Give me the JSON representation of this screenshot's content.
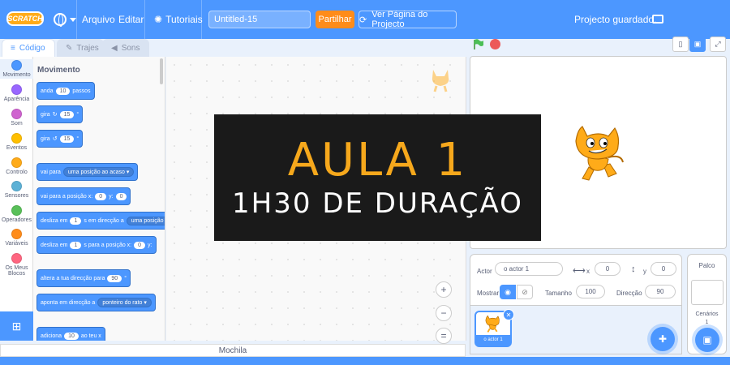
{
  "menu": {
    "logo": "SCRATCH",
    "file": "Arquivo",
    "edit": "Editar",
    "tutorials": "Tutoriais",
    "project_title": "Untitled-15",
    "share": "Partilhar",
    "see_project": "Ver Página do Projecto",
    "saved_status": "Projecto guardado."
  },
  "tabs": {
    "code": "Código",
    "costumes": "Trajes",
    "sounds": "Sons"
  },
  "categories": [
    {
      "label": "Movimento",
      "color": "#4c97ff"
    },
    {
      "label": "Aparência",
      "color": "#9966ff"
    },
    {
      "label": "Som",
      "color": "#cf63cf"
    },
    {
      "label": "Eventos",
      "color": "#ffbf00"
    },
    {
      "label": "Controlo",
      "color": "#ffab19"
    },
    {
      "label": "Sensores",
      "color": "#5cb1d6"
    },
    {
      "label": "Operadores",
      "color": "#59c059"
    },
    {
      "label": "Variáveis",
      "color": "#ff8c1a"
    },
    {
      "label": "Os Meus Blocos",
      "color": "#ff6680"
    }
  ],
  "palette": {
    "title": "Movimento",
    "move": {
      "a": "anda",
      "value": "10",
      "b": "passos"
    },
    "turn_right": {
      "a": "gira",
      "value": "15",
      "b": "°"
    },
    "turn_left": {
      "a": "gira",
      "value": "15",
      "b": "°"
    },
    "goto": {
      "a": "vai para",
      "option": "uma posição ao acaso"
    },
    "goto_xy": {
      "a": "vai para a posição x:",
      "x": "0",
      "b": "y:",
      "y": "0"
    },
    "glide": {
      "a": "desliza em",
      "value": "1",
      "b": "s em direcção a",
      "option": "uma posição"
    },
    "glide_xy": {
      "a": "desliza em",
      "value": "1",
      "b": "s para a posição x:",
      "x": "0",
      "c": "y:"
    },
    "point": {
      "a": "altera a tua direcção para",
      "value": "90",
      "b": "°"
    },
    "point_towards": {
      "a": "aponta em direcção a",
      "option": "ponteiro do rato"
    },
    "change_x": {
      "a": "adiciona",
      "value": "10",
      "b": "ao teu x"
    }
  },
  "zoom": {
    "in": "+",
    "out": "−",
    "reset": "="
  },
  "backpack": "Mochila",
  "sprite": {
    "label": "Actor",
    "name": "o actor 1",
    "x_label": "x",
    "x": "0",
    "y_label": "y",
    "y": "0",
    "show_label": "Mostrar",
    "size_label": "Tamanho",
    "size": "100",
    "direction_label": "Direcção",
    "direction": "90",
    "card_name": "o actor 1"
  },
  "stage_panel": {
    "title": "Palco",
    "backdrops_label": "Cenários",
    "backdrops_count": "1"
  },
  "banner": {
    "title": "AULA 1",
    "subtitle": "1H30 DE DURAÇÃO"
  },
  "colors": {
    "accent": "#4c97ff",
    "share": "#ff8c1a",
    "banner_title": "#f6a81c"
  }
}
